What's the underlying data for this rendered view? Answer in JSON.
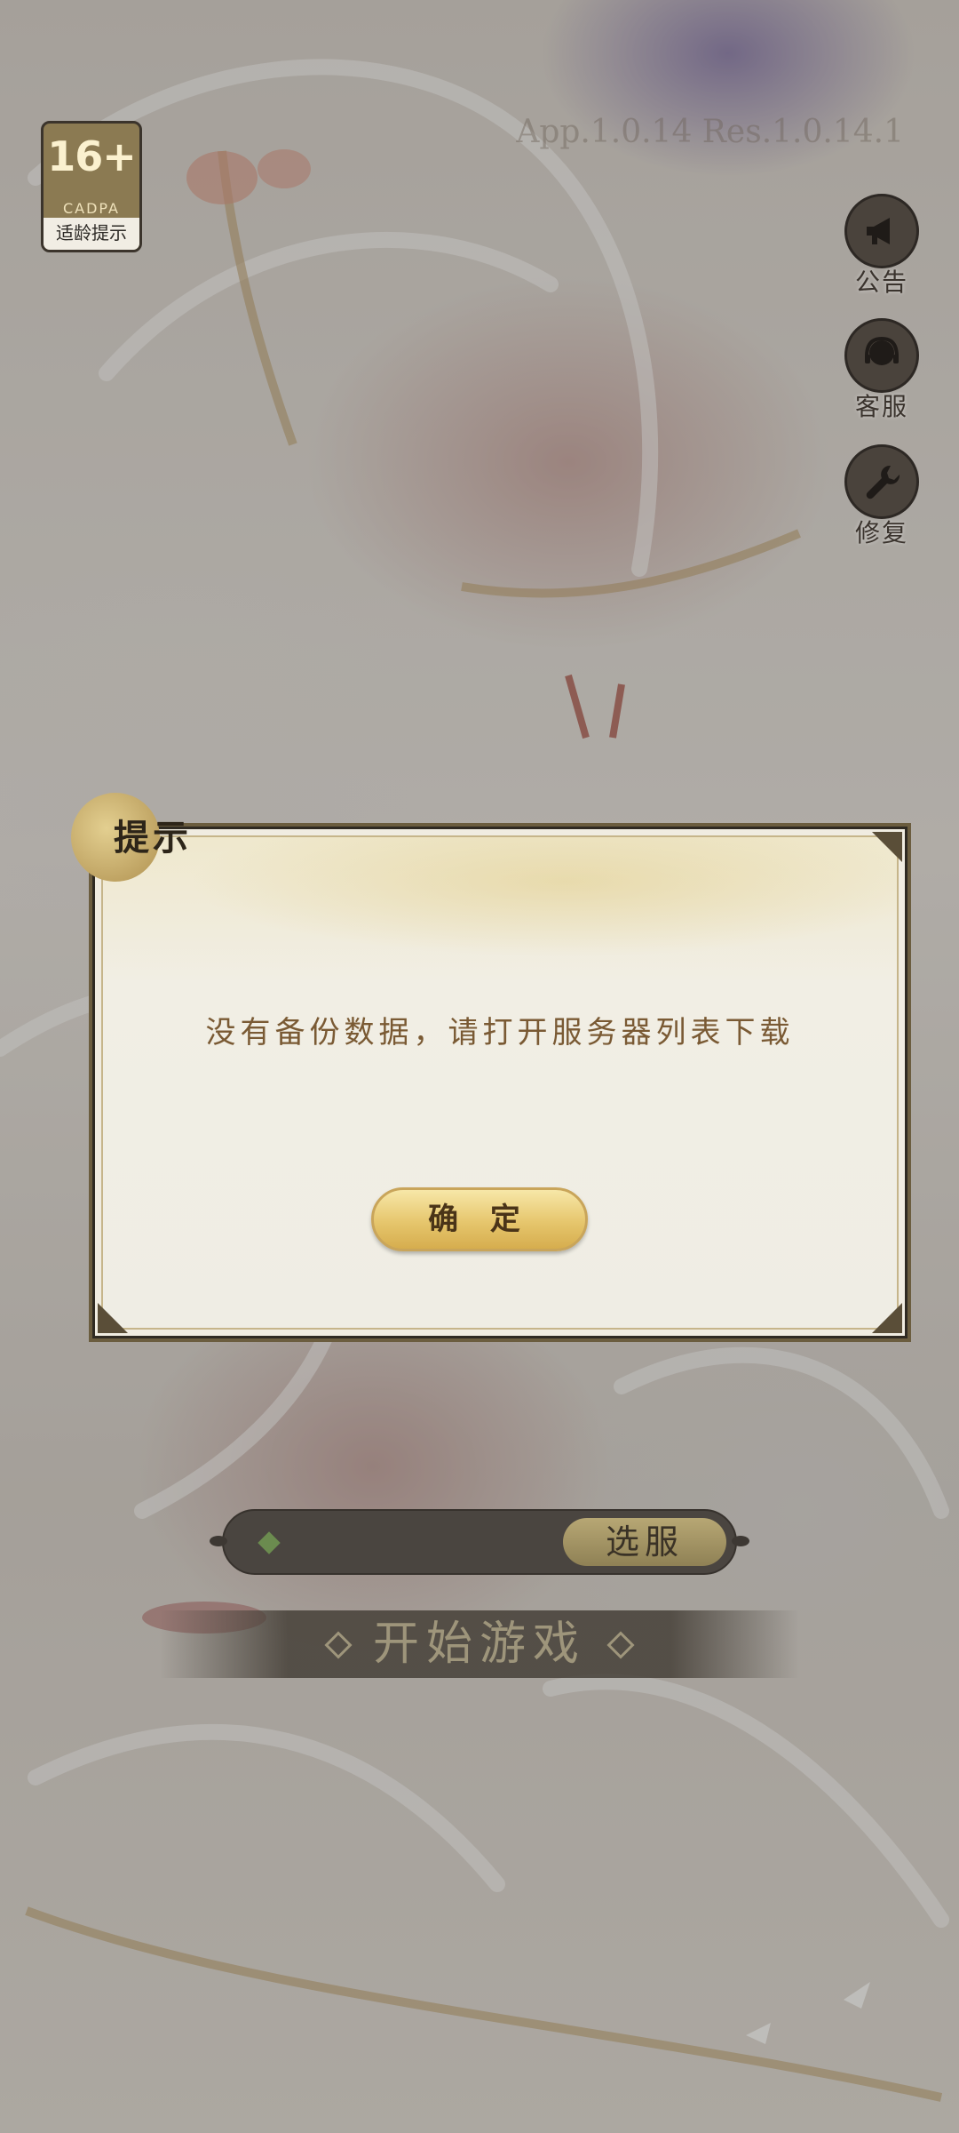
{
  "age_rating": {
    "number": "16+",
    "org": "CADPA",
    "tip": "适龄提示"
  },
  "version": "App.1.0.14 Res.1.0.14.1",
  "side_buttons": [
    {
      "label": "公告",
      "icon": "megaphone-icon"
    },
    {
      "label": "客服",
      "icon": "customer-service-icon"
    },
    {
      "label": "修复",
      "icon": "wrench-icon"
    }
  ],
  "dialog": {
    "title": "提示",
    "message": "没有备份数据，请打开服务器列表下载",
    "confirm_label": "确 定"
  },
  "server": {
    "select_label": "选服"
  },
  "start": {
    "label": "开始游戏"
  },
  "colors": {
    "dialog_text": "#7a5a34",
    "button_gold": "#e6c66d",
    "overlay": "#5a5046"
  }
}
